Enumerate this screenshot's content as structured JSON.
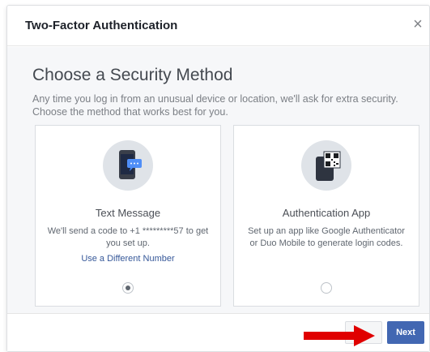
{
  "dialog": {
    "title": "Two-Factor Authentication",
    "close_label": "×"
  },
  "main": {
    "heading": "Choose a Security Method",
    "description": "Any time you log in from an unusual device or location, we'll ask for extra security. Choose the method that works best for you."
  },
  "methods": [
    {
      "title": "Text Message",
      "description": "We'll send a code to +1 *********57 to get you set up.",
      "link": "Use a Different Number",
      "selected": true,
      "icon": "phone-message-icon"
    },
    {
      "title": "Authentication App",
      "description": "Set up an app like Google Authenticator or Duo Mobile to generate login codes.",
      "selected": false,
      "icon": "qr-code-icon"
    }
  ],
  "footer": {
    "next_label": "Next"
  },
  "colors": {
    "primary": "#4267b2",
    "link": "#365899",
    "annotation_arrow": "#e00000"
  }
}
